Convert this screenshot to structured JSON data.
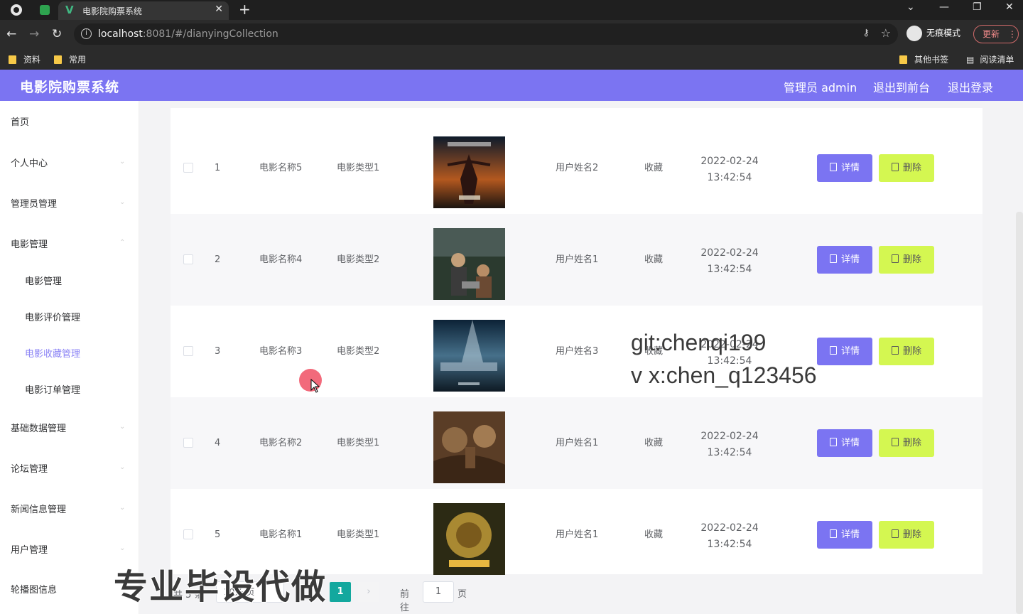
{
  "browser": {
    "tab_title": "电影院购票系统",
    "url_host": "localhost",
    "url_rest": ":8081/#/dianyingCollection",
    "incognito_label": "无痕模式",
    "update_label": "更新",
    "bookmarks": [
      "资料",
      "常用"
    ],
    "bookmarks_right": [
      "其他书签",
      "阅读清单"
    ]
  },
  "header": {
    "title": "电影院购票系统",
    "admin_label": "管理员 admin",
    "back_label": "退出到前台",
    "logout_label": "退出登录"
  },
  "sidebar": {
    "items": [
      "首页",
      "个人中心",
      "管理员管理",
      "电影管理"
    ],
    "sub_items": [
      "电影管理",
      "电影评价管理",
      "电影收藏管理",
      "电影订单管理"
    ],
    "items_after": [
      "基础数据管理",
      "论坛管理",
      "新闻信息管理",
      "用户管理",
      "轮播图信息"
    ]
  },
  "table": {
    "rows": [
      {
        "index": "1",
        "name": "电影名称5",
        "type": "电影类型1",
        "user": "用户姓名2",
        "kind": "收藏",
        "date": "2022-02-24",
        "time": "13:42:54"
      },
      {
        "index": "2",
        "name": "电影名称4",
        "type": "电影类型2",
        "user": "用户姓名1",
        "kind": "收藏",
        "date": "2022-02-24",
        "time": "13:42:54"
      },
      {
        "index": "3",
        "name": "电影名称3",
        "type": "电影类型2",
        "user": "用户姓名3",
        "kind": "收藏",
        "date": "2022-02-24",
        "time": "13:42:54"
      },
      {
        "index": "4",
        "name": "电影名称2",
        "type": "电影类型1",
        "user": "用户姓名1",
        "kind": "收藏",
        "date": "2022-02-24",
        "time": "13:42:54"
      },
      {
        "index": "5",
        "name": "电影名称1",
        "type": "电影类型1",
        "user": "用户姓名1",
        "kind": "收藏",
        "date": "2022-02-24",
        "time": "13:42:54"
      }
    ],
    "detail_label": "详情",
    "delete_label": "删除"
  },
  "pagination": {
    "total": "共 5 条",
    "page_size": "10条/页",
    "current_page": "1",
    "goto_label": "前往",
    "goto_value": "1",
    "page_label": "页"
  },
  "overlay": {
    "watermark_line1": "git:chenqi199",
    "watermark_line2": "v x:chen_q123456",
    "promo": "专业毕设代做"
  },
  "colors": {
    "brand": "#7b74f2",
    "delete_button": "#d4f751",
    "active_page": "#13a89e"
  }
}
